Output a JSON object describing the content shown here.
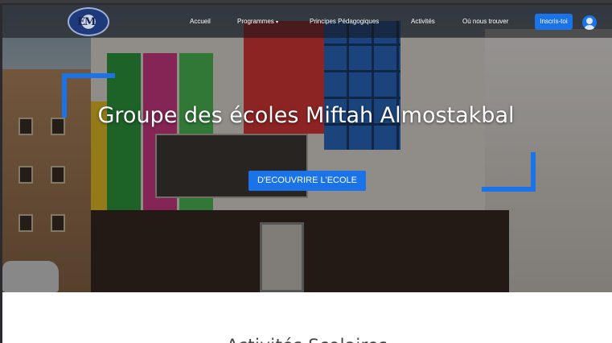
{
  "navbar": {
    "logo_alt": "logo-icon",
    "items": [
      {
        "label": "Accueil"
      },
      {
        "label": "Programmes",
        "has_dropdown": true
      },
      {
        "label": "Principes Pédagogiques"
      },
      {
        "label": "Activités"
      },
      {
        "label": "Où nous trouver"
      }
    ],
    "dropdown_caret": "▾",
    "signup_label": "Inscris-toi",
    "user_icon": "user-icon"
  },
  "hero": {
    "title": "Groupe des écoles Miftah Almostakbal",
    "cta_label": "D'ECOUVRIRE L'ECOLE"
  },
  "section": {
    "title": "Activités Scolaires"
  },
  "colors": {
    "accent": "#1a73e8",
    "navbar_bg": "#141418",
    "white_section": "#ffffff"
  }
}
